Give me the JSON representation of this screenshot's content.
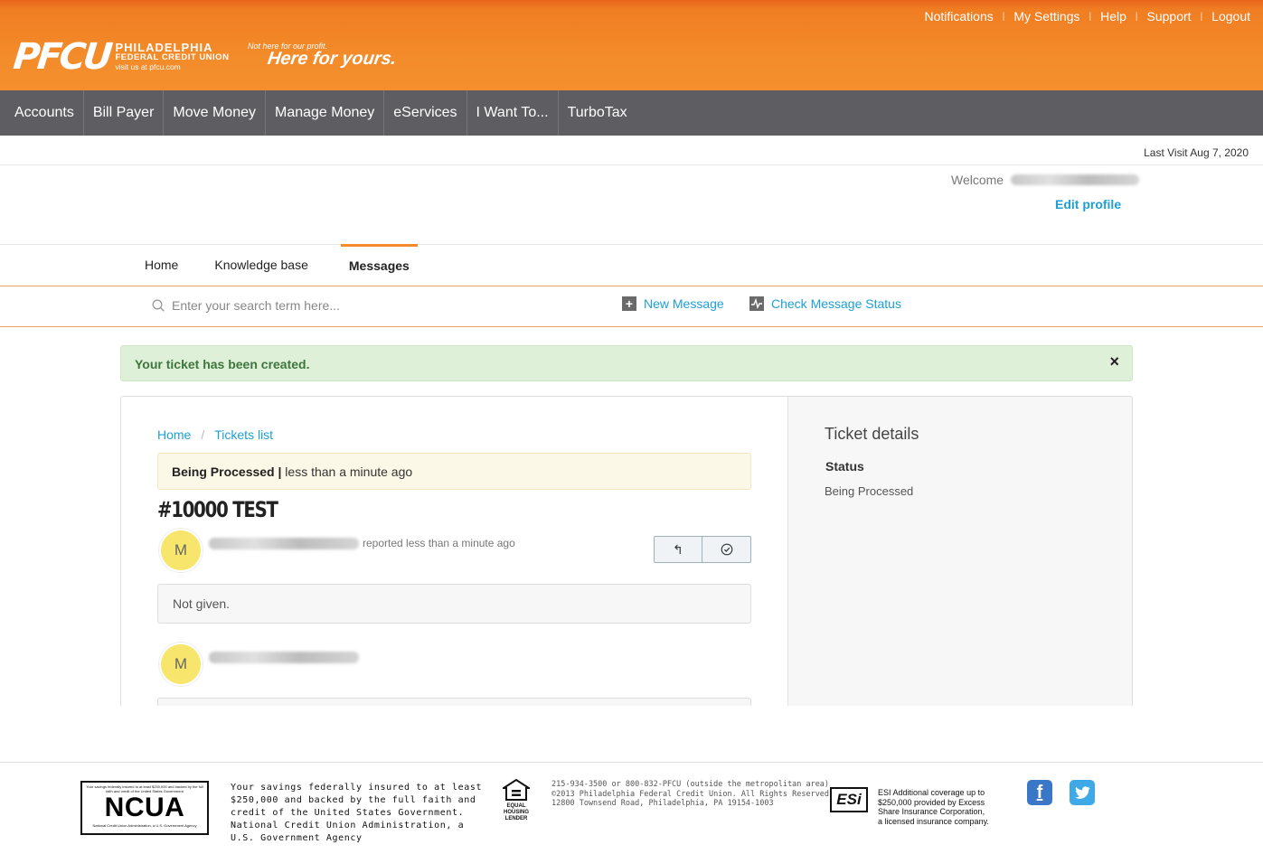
{
  "top_links": [
    "Notifications",
    "My Settings",
    "Help",
    "Support",
    "Logout"
  ],
  "logo": {
    "mark": "PFCU",
    "line1": "PHILADELPHIA",
    "line2": "FEDERAL CREDIT UNION",
    "line3": "visit us at pfcu.com"
  },
  "tagline": {
    "small": "Not here for our profit.",
    "big": "Here for yours."
  },
  "main_nav": [
    "Accounts",
    "Bill Payer",
    "Move Money",
    "Manage Money",
    "eServices",
    "I Want To...",
    "TurboTax"
  ],
  "last_visit": "Last Visit Aug 7, 2020",
  "welcome": {
    "label": "Welcome",
    "edit_profile": "Edit profile"
  },
  "tabs": {
    "home": "Home",
    "knowledge_base": "Knowledge base",
    "messages": "Messages"
  },
  "search": {
    "placeholder": "Enter your search term here..."
  },
  "actions": {
    "new_message": "New Message",
    "check_status": "Check Message Status"
  },
  "alert": {
    "text": "Your ticket has been created.",
    "close": "×"
  },
  "breadcrumb": {
    "home": "Home",
    "sep": "/",
    "tickets": "Tickets list"
  },
  "status_box": {
    "status": "Being Processed |",
    "time": " less than a minute ago"
  },
  "ticket": {
    "title": "#10000 TEST",
    "avatar_initial": "M",
    "reported": "reported less than a minute ago",
    "message": "Not given.",
    "reply_icon": "↰",
    "resolve_icon": "✓"
  },
  "details": {
    "title": "Ticket details",
    "status_label": "Status",
    "status_value": "Being Processed"
  },
  "footer": {
    "ncua_top": "Your savings federally insured to at least $250,000 and backed by the full faith and credit of the United States Government",
    "ncua_big": "NCUA",
    "ncua_bottom": "National Credit Union Administration, a U.S. Government Agency",
    "insured_text": "Your savings federally insured to at least $250,000 and backed by the full faith and credit of the United States Government. National Credit Union Administration, a U.S. Government Agency",
    "ehl": "EQUAL HOUSING LENDER",
    "address": [
      "215-934-3500 or 800-832-PFCU (outside the metropolitan area)",
      "©2013 Philadelphia Federal Credit Union. All Rights Reserved.",
      "12800 Townsend Road, Philadelphia, PA 19154-1003"
    ],
    "esi_logo": "ESi",
    "esi_text": [
      "ESI Additional coverage up to",
      "$250,000 provided by Excess",
      "Share Insurance Corporation,",
      "a licensed insurance company."
    ],
    "facebook": "f",
    "twitter": "t"
  },
  "colors": {
    "header_orange": "#f38b2a",
    "nav_gray": "#5d5d62",
    "link_blue": "#1d9fd6",
    "alert_green": "#dff0d8",
    "avatar_yellow": "#f7e66b"
  }
}
